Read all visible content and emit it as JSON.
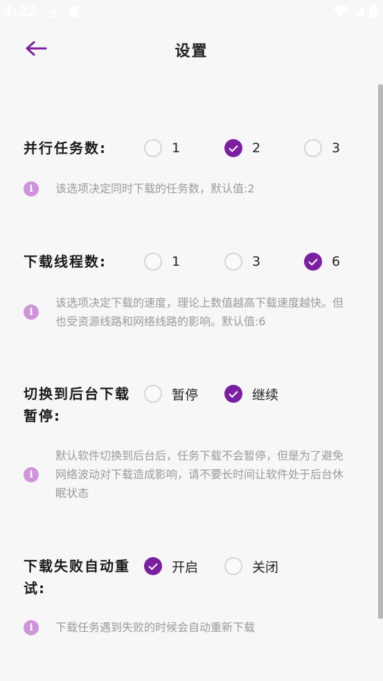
{
  "status_bar": {
    "time": "4:22",
    "icons": [
      "download-icon",
      "sd-card-icon",
      "wifi-icon",
      "signal-icon",
      "battery-icon"
    ]
  },
  "app_bar": {
    "title": "设置",
    "back_icon": "back-arrow-icon"
  },
  "colors": {
    "accent": "#7b1fa2",
    "info_icon": "#ce93d8",
    "hint_text": "#9a9a9a"
  },
  "settings": [
    {
      "label": "并行任务数:",
      "options": [
        {
          "label": "1",
          "checked": false
        },
        {
          "label": "2",
          "checked": true
        },
        {
          "label": "3",
          "checked": false
        }
      ],
      "info": "该选项决定同时下载的任务数，默认值:2"
    },
    {
      "label": "下载线程数:",
      "options": [
        {
          "label": "1",
          "checked": false
        },
        {
          "label": "3",
          "checked": false
        },
        {
          "label": "6",
          "checked": true
        }
      ],
      "info": "该选项决定下载的速度，理论上数值越高下载速度越快。但也受资源线路和网络线路的影响。默认值:6"
    },
    {
      "label": "切换到后台下载暂停:",
      "options": [
        {
          "label": "暂停",
          "checked": false
        },
        {
          "label": "继续",
          "checked": true
        }
      ],
      "info": "默认软件切换到后台后，任务下载不会暂停，但是为了避免网络波动对下载造成影响，请不要长时间让软件处于后台休眠状态"
    },
    {
      "label": "下载失败自动重试:",
      "options": [
        {
          "label": "开启",
          "checked": true
        },
        {
          "label": "关闭",
          "checked": false
        }
      ],
      "info": "下载任务遇到失败的时候会自动重新下载"
    }
  ]
}
